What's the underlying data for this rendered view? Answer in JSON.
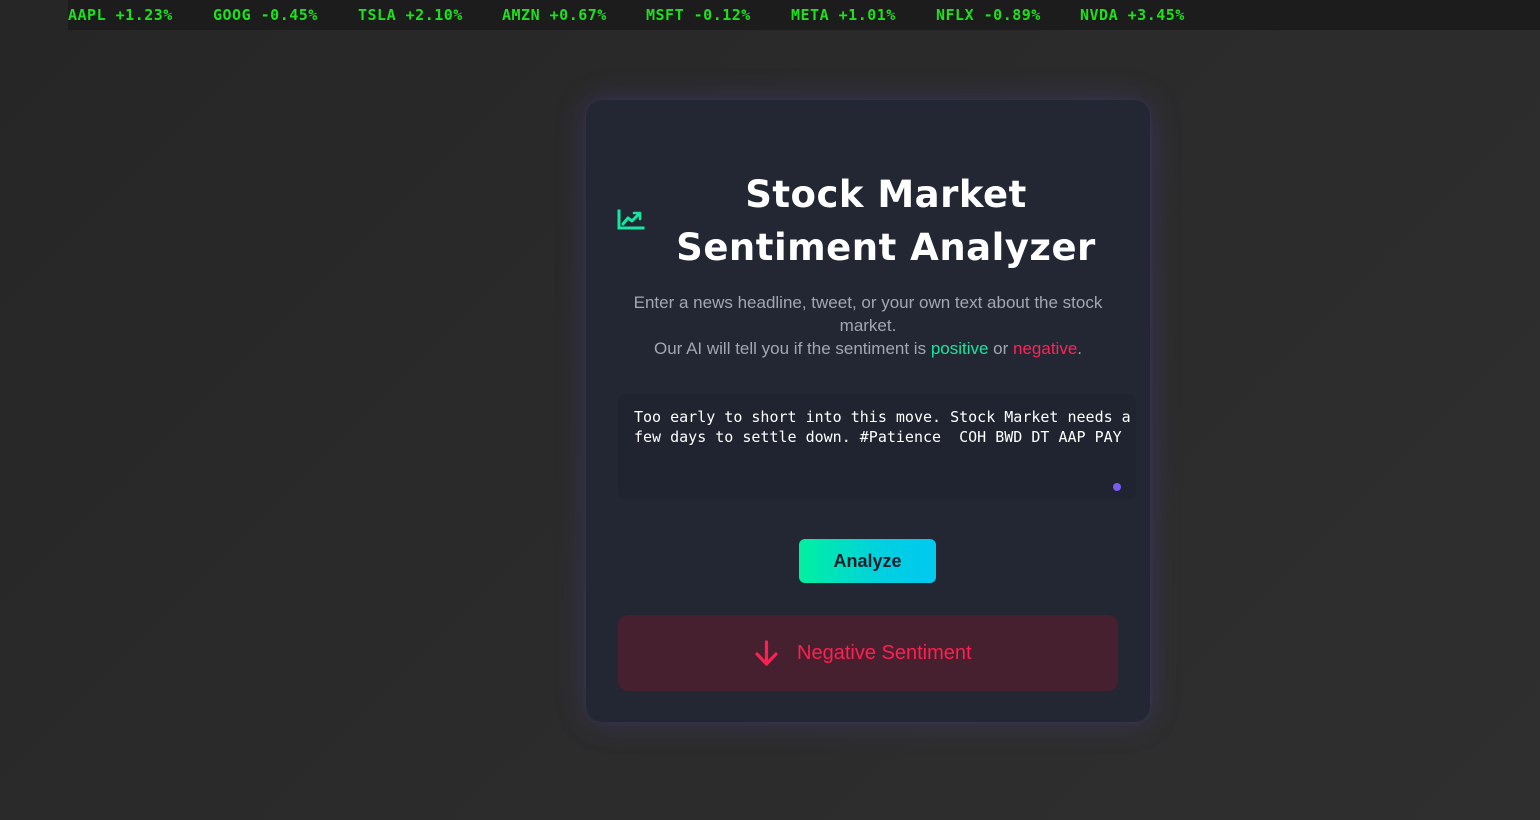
{
  "ticker": {
    "items": [
      {
        "symbol": "AAPL",
        "change": "+1.23%"
      },
      {
        "symbol": "GOOG",
        "change": "-0.45%"
      },
      {
        "symbol": "TSLA",
        "change": "+2.10%"
      },
      {
        "symbol": "AMZN",
        "change": "+0.67%"
      },
      {
        "symbol": "MSFT",
        "change": "-0.12%"
      },
      {
        "symbol": "META",
        "change": "+1.01%"
      },
      {
        "symbol": "NFLX",
        "change": "-0.89%"
      },
      {
        "symbol": "NVDA",
        "change": "+3.45%"
      }
    ],
    "color": "#1ee01e"
  },
  "card": {
    "icon": "chart-line-icon",
    "title_line1": "Stock Market",
    "title_line2": "Sentiment Analyzer",
    "description_line1": "Enter a news headline, tweet, or your own text about the stock market.",
    "description_prefix": "Our AI will tell you if the sentiment is ",
    "description_positive": "positive",
    "description_middle": " or ",
    "description_negative": "negative",
    "description_suffix": ".",
    "input_value": "Too early to short into this move. Stock Market needs a few days to settle down. #Patience  COH BWD DT AAP PAY",
    "analyze_label": "Analyze",
    "result_icon": "arrow-down-icon",
    "result_label": "Negative Sentiment"
  },
  "colors": {
    "positive": "#17e6a0",
    "negative": "#ff2355",
    "accent_gradient_start": "#00f0a0",
    "accent_gradient_end": "#00c8f0",
    "card_background": "#222733"
  }
}
